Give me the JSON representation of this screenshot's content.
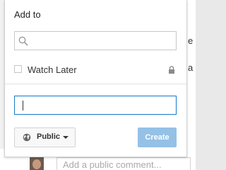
{
  "dialog": {
    "title": "Add to",
    "search": {
      "value": "",
      "placeholder": ""
    },
    "playlists": [
      {
        "label": "Watch Later",
        "checked": false,
        "private": true
      }
    ],
    "new_playlist": {
      "value": ""
    },
    "privacy": {
      "selected": "Public",
      "icon": "globe-icon"
    },
    "create_label": "Create"
  },
  "background": {
    "comment_placeholder": "Add a public comment...",
    "right_chars": [
      "e",
      "a"
    ]
  },
  "colors": {
    "focus_border": "#167ac6",
    "create_disabled": "#95c1e6"
  }
}
